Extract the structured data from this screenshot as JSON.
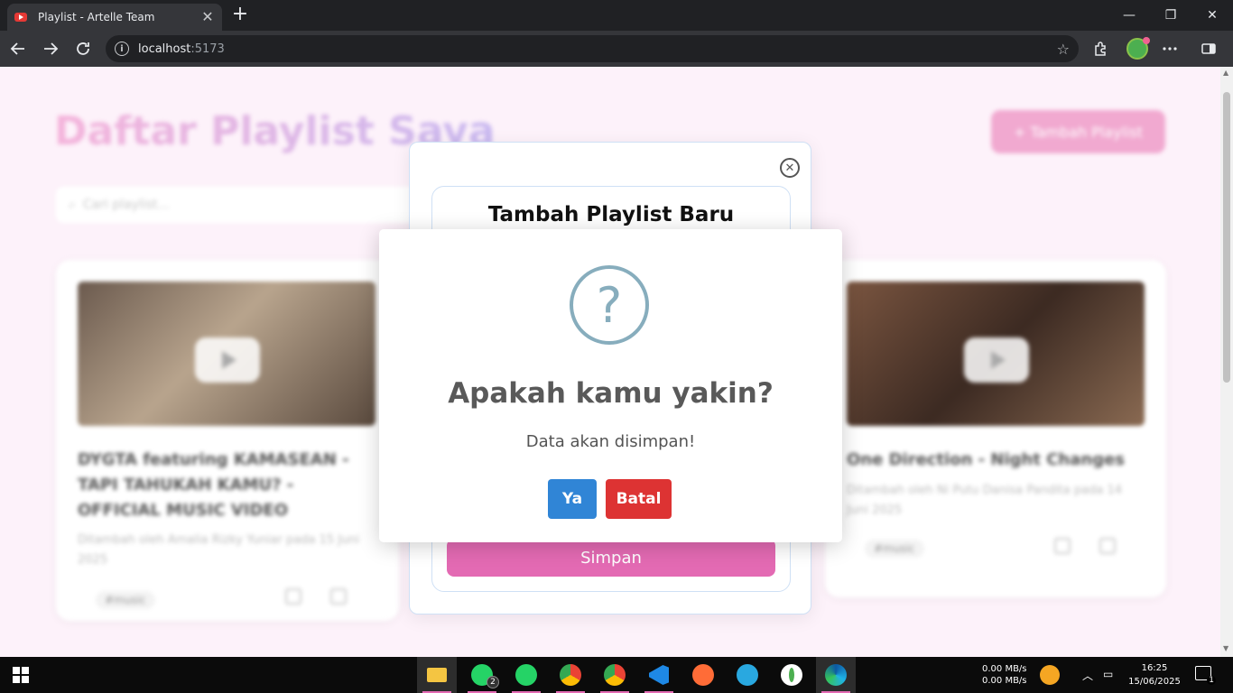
{
  "browser": {
    "tab_title": "Playlist - Artelle Team",
    "tab_close": "✕",
    "new_tab": "+",
    "url_host": "localhost",
    "url_port": ":5173",
    "min": "—",
    "restore": "❐",
    "close": "✕"
  },
  "page": {
    "title": "Daftar Playlist Saya",
    "add_button": "+ Tambah Playlist",
    "search_placeholder": "Cari playlist...",
    "cards": [
      {
        "title": "DYGTA featuring KAMASEAN - TAPI TAHUKAH KAMU? - OFFICIAL MUSIC VIDEO",
        "meta": "Ditambah oleh Amalia Rizky Yuniar pada 15 Juni 2025",
        "tag": "#music"
      },
      {
        "title": "One Direction - Night Changes",
        "meta": "Ditambah oleh Ni Putu Danisa Pandita pada 14 Juni 2025",
        "tag": "#music"
      }
    ]
  },
  "add_modal": {
    "title": "Tambah Playlist Baru",
    "save_label": "Simpan"
  },
  "confirm": {
    "icon": "?",
    "title": "Apakah kamu yakin?",
    "text": "Data akan disimpan!",
    "yes_label": "Ya",
    "cancel_label": "Batal"
  },
  "taskbar": {
    "net_up": "0.00 MB/s",
    "net_down": "0.00 MB/s",
    "time": "16:25",
    "date": "15/06/2025",
    "whatsapp_badge": "2",
    "notif_badge": "1"
  },
  "colors": {
    "accent_pink": "#e36ab3",
    "confirm_yes": "#3085d6",
    "confirm_no": "#dd3333",
    "question_icon": "#87adbd"
  }
}
